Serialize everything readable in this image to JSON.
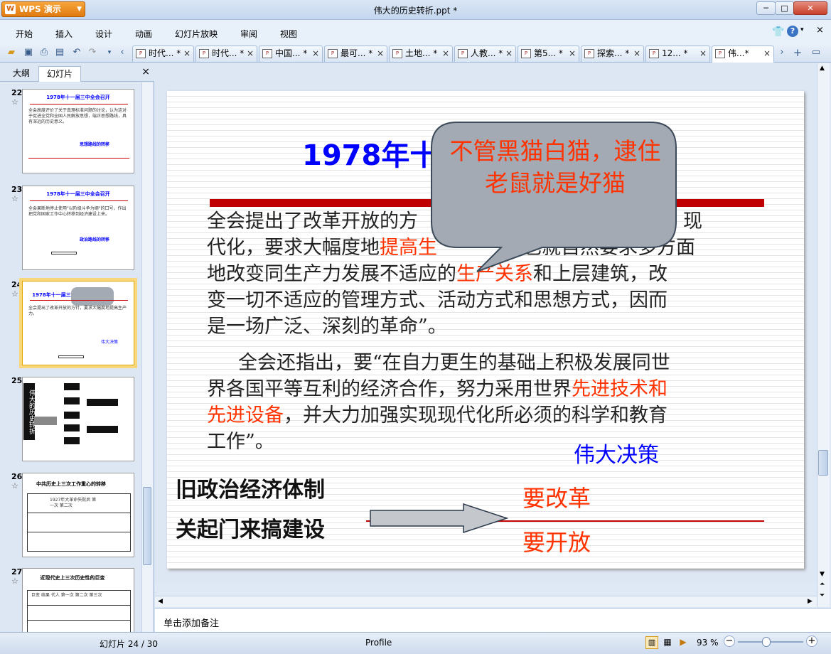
{
  "app": {
    "menu_label": "WPS 演示",
    "logo_text": "W"
  },
  "window": {
    "title": "伟大的历史转折.ppt *",
    "minimize": "─",
    "maximize": "□",
    "close": "✕"
  },
  "menu": [
    "开始",
    "插入",
    "设计",
    "动画",
    "幻灯片放映",
    "审阅",
    "视图"
  ],
  "tabs": [
    {
      "label": "时代... *"
    },
    {
      "label": "时代... *"
    },
    {
      "label": "中国... *"
    },
    {
      "label": "最可... *"
    },
    {
      "label": "土地... *"
    },
    {
      "label": "人教... *"
    },
    {
      "label": "第5... *"
    },
    {
      "label": "探索... *"
    },
    {
      "label": "12... *"
    },
    {
      "label": "伟...*"
    }
  ],
  "panel": {
    "tab_outline": "大纲",
    "tab_slides": "幻灯片",
    "close": "×"
  },
  "thumbnails": [
    {
      "num": "22",
      "title": "1978年十一届三中全会召开",
      "line1": "全会高度评价了关于真理标准问题的讨论，认为这对于促进全党和全国人民解放思想，端正思想路线，具有深远的历史意义。",
      "tag": "思想路线的转移"
    },
    {
      "num": "23",
      "title": "1978年十一届三中全会召开",
      "line1": "全会果断地停止使用\"以阶级斗争为纲\"的口号，作出把党和国家工作中心转移到经济建设上来。",
      "tag": "政治路线的转移"
    },
    {
      "num": "24",
      "title": "1978年十一届三中全会召开",
      "line1": "全会提出了改革开放的方针，要求大幅度地提高生产力。",
      "tag": "伟大决策"
    },
    {
      "num": "25",
      "title": "伟大的历史转折",
      "line1": "确立 两个伟大转折 作出 实行 两个伟大起点 形成",
      "tag": ""
    },
    {
      "num": "26",
      "title": "中共历史上三次工作重心的转移",
      "line1": "1927年大革命失败后 第一次 第二次",
      "tag": ""
    },
    {
      "num": "27",
      "title": "近现代史上三次历史性的巨变",
      "line1": "巨变 结果 代人 第一次 第二次 第三次",
      "tag": ""
    }
  ],
  "slide": {
    "title_part": "1978年十",
    "callout": "不管黑猫白猫，逮住老鼠就是好猫",
    "para1_a": "全会提出了改革开放的方",
    "para1_b": "现",
    "para1_c": "代化，要求大幅度地",
    "para1_c_red": "提高生",
    "para1_d": "也就自然要求多方面",
    "para1_e": "地改变同生产力发展不适应的",
    "para1_e_red": "生产关系",
    "para1_f": "和上层建筑，改",
    "para1_g": "变一切不适应的管理方式、活动方式和思想方式，因而",
    "para1_h": "是一场广泛、深刻的革命”。",
    "para2_a": "全会还指出，要“在自力更生的基础上积极发展同世",
    "para2_b": "界各国平等互利的经济合作，努力采用世界",
    "para2_b_red": "先进技术和",
    "para2_c_red": "先进设备",
    "para2_c": "，并大力加强实现现代化所必须的科学和教育",
    "para2_d": "工作”。",
    "decision": "伟大决策",
    "old_system": "旧政治经济体制",
    "closed": "关起门来搞建设",
    "reform": "要改革",
    "open": "要开放"
  },
  "notes": {
    "placeholder": "单击添加备注"
  },
  "status": {
    "slide_counter": "幻灯片 24 / 30",
    "profile": "Profile",
    "zoom": "93 %"
  },
  "colors": {
    "accent_blue": "#0000ff",
    "accent_red": "#ff3300",
    "callout_fill": "#a3aab3"
  }
}
